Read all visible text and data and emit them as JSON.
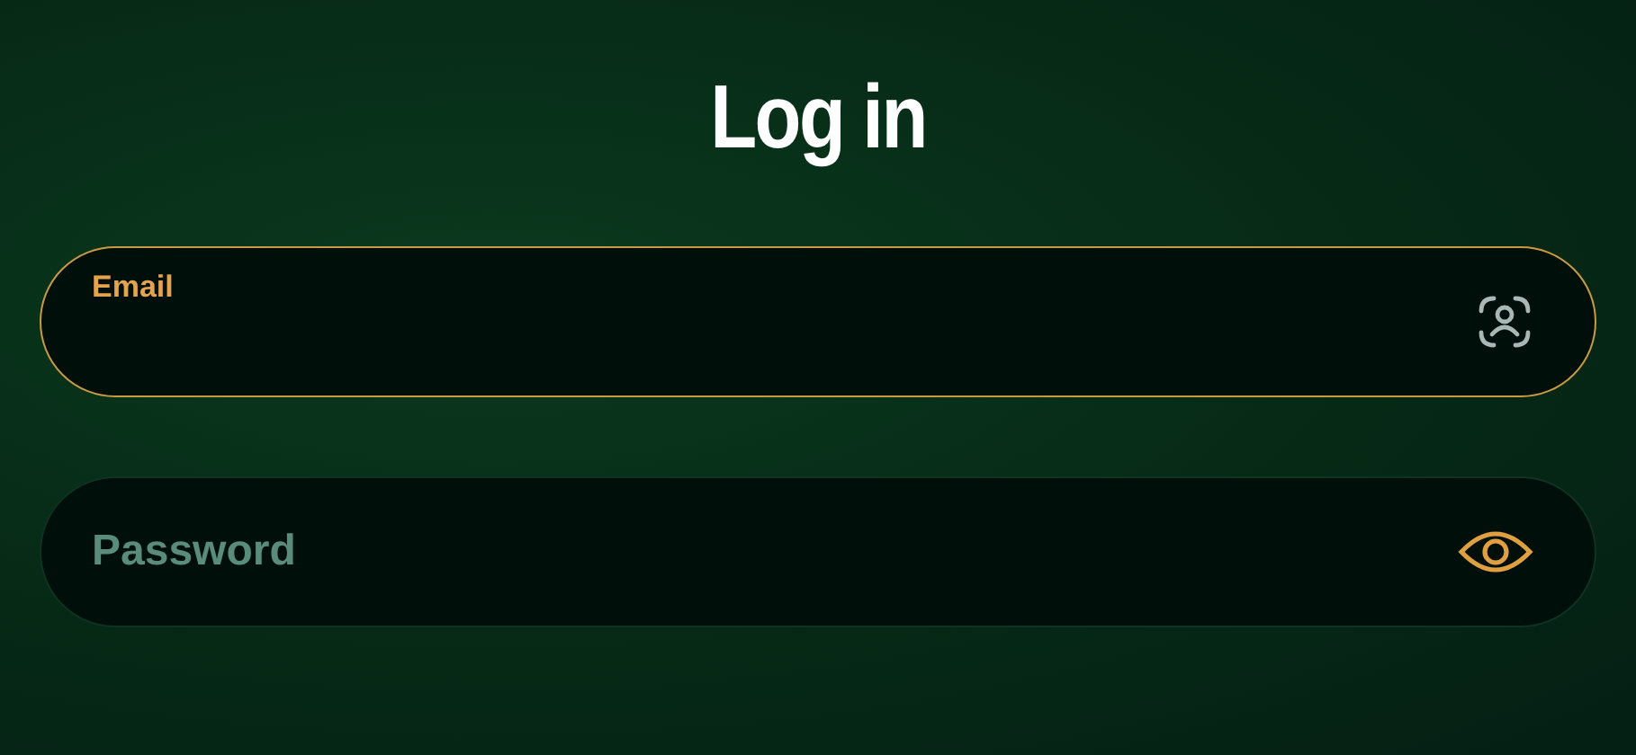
{
  "title": "Log in",
  "fields": [
    {
      "kind": "email",
      "label": "Email",
      "focused": true
    },
    {
      "kind": "password",
      "placeholder": "Password",
      "focused": false
    }
  ]
}
